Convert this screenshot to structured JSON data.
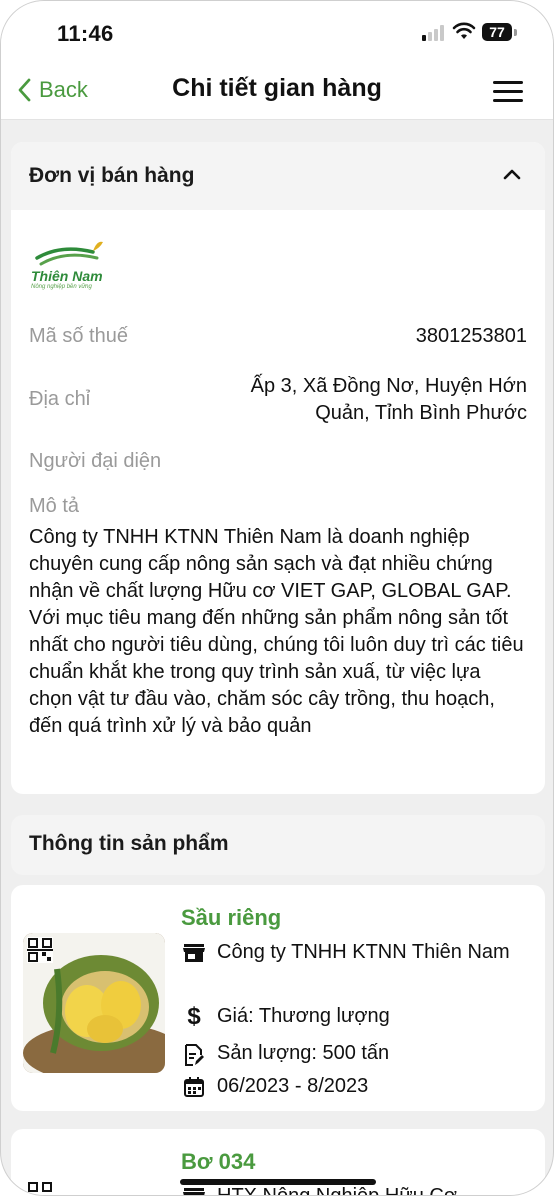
{
  "status_bar": {
    "time": "11:46",
    "battery": "77"
  },
  "nav": {
    "back_label": "Back",
    "title": "Chi tiết gian hàng"
  },
  "seller_section": {
    "title": "Đơn vị bán hàng",
    "logo": {
      "name": "Thiên Nam",
      "slogan": "Nông nghiệp bền vững"
    },
    "tax_label": "Mã số thuế",
    "tax_value": "3801253801",
    "address_label": "Địa chỉ",
    "address_line1": "Ấp 3, Xã Đồng Nơ, Huyện Hớn",
    "address_line2": "Quản, Tỉnh Bình Phước",
    "rep_label": "Người đại diện",
    "desc_label": "Mô tả",
    "description": "Công ty TNHH KTNN Thiên Nam là doanh nghiệp chuyên cung cấp nông sản sạch và đạt nhiều chứng nhận về chất lượng Hữu cơ VIET GAP, GLOBAL GAP. Với mục tiêu mang đến những sản phẩm nông sản tốt nhất cho người tiêu dùng, chúng tôi luôn duy trì các tiêu chuẩn khắt khe trong quy trình sản xuấ, từ việc lựa chọn vật tư đầu vào, chăm sóc cây trồng, thu hoạch, đến quá trình xử lý và bảo quản"
  },
  "product_section": {
    "title": "Thông tin sản phẩm",
    "products": [
      {
        "name": "Sầu riêng",
        "company": "Công ty TNHH KTNN Thiên Nam",
        "price": "Giá: Thương lượng",
        "yield": "Sản lượng: 500 tấn",
        "period": "06/2023 - 8/2023"
      },
      {
        "name": "Bơ 034",
        "company": "HTX Nông Nghiệp Hữu Cơ"
      }
    ]
  },
  "colors": {
    "accent": "#4a9a3f",
    "background": "#efefef",
    "card": "#ffffff"
  }
}
